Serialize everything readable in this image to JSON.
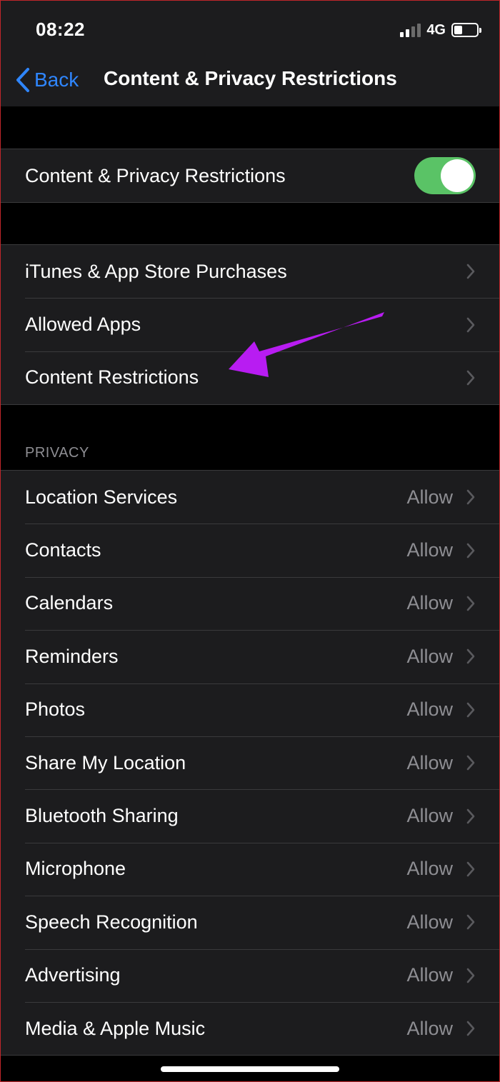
{
  "status_bar": {
    "time": "08:22",
    "network": "4G",
    "signal_bars": 4,
    "signal_bars_active": 2,
    "battery_level": 0.35
  },
  "nav": {
    "back_label": "Back",
    "title": "Content & Privacy Restrictions"
  },
  "master": {
    "label": "Content & Privacy Restrictions",
    "enabled": true
  },
  "restrictions": {
    "items": [
      {
        "label": "iTunes & App Store Purchases"
      },
      {
        "label": "Allowed Apps"
      },
      {
        "label": "Content Restrictions"
      }
    ]
  },
  "privacy": {
    "header": "PRIVACY",
    "items": [
      {
        "label": "Location Services",
        "value": "Allow"
      },
      {
        "label": "Contacts",
        "value": "Allow"
      },
      {
        "label": "Calendars",
        "value": "Allow"
      },
      {
        "label": "Reminders",
        "value": "Allow"
      },
      {
        "label": "Photos",
        "value": "Allow"
      },
      {
        "label": "Share My Location",
        "value": "Allow"
      },
      {
        "label": "Bluetooth Sharing",
        "value": "Allow"
      },
      {
        "label": "Microphone",
        "value": "Allow"
      },
      {
        "label": "Speech Recognition",
        "value": "Allow"
      },
      {
        "label": "Advertising",
        "value": "Allow"
      },
      {
        "label": "Media & Apple Music",
        "value": "Allow"
      }
    ]
  },
  "colors": {
    "accent": "#2f86ff",
    "toggle_on": "#5ac366",
    "annotation_arrow": "#b81cf2"
  }
}
